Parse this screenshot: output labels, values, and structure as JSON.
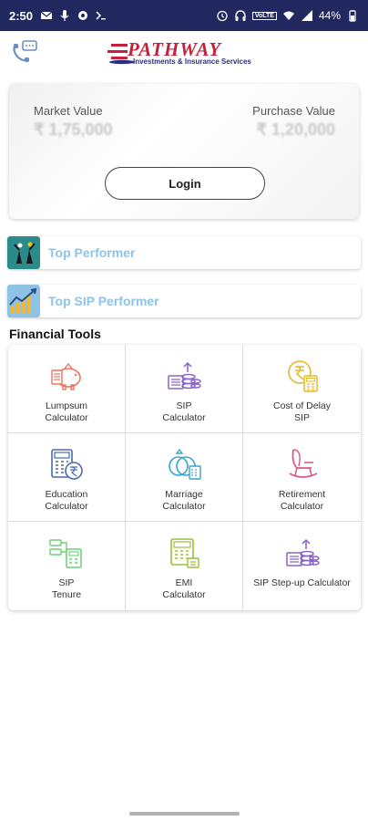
{
  "status_bar": {
    "time": "2:50",
    "network_label": "VoLTE",
    "battery": "44%"
  },
  "header": {
    "brand": "PATHWAY",
    "subtitle": "Investments & Insurance Services"
  },
  "market_card": {
    "market_value_label": "Market Value",
    "market_value": "₹ 1,75,000",
    "purchase_value_label": "Purchase Value",
    "purchase_value": "₹ 1,20,000",
    "login_label": "Login"
  },
  "performers": [
    {
      "label": "Top Performer",
      "icon": "top-performer-icon"
    },
    {
      "label": "Top SIP Performer",
      "icon": "top-sip-performer-icon"
    }
  ],
  "financial_tools": {
    "title": "Financial Tools",
    "items": [
      {
        "label": "Lumpsum\nCalculator",
        "icon": "piggy-bank-icon",
        "color": "#f0735f"
      },
      {
        "label": "SIP\nCalculator",
        "icon": "coin-stack-icon",
        "color": "#8a63c9"
      },
      {
        "label": "Cost of Delay\nSIP",
        "icon": "rupee-calculator-icon",
        "color": "#e6b826"
      },
      {
        "label": "Education\nCalculator",
        "icon": "education-calculator-icon",
        "color": "#4a6bb5"
      },
      {
        "label": "Marriage\nCalculator",
        "icon": "marriage-rings-icon",
        "color": "#3ba4c9"
      },
      {
        "label": "Retirement\nCalculator",
        "icon": "rocking-chair-icon",
        "color": "#d95a82"
      },
      {
        "label": "SIP\nTenure",
        "icon": "sip-tenure-icon",
        "color": "#6bcf74"
      },
      {
        "label": "EMI\nCalculator",
        "icon": "emi-calendar-icon",
        "color": "#9bbf3a"
      },
      {
        "label": "SIP Step-up Calculator",
        "icon": "step-up-coins-icon",
        "color": "#8a63c9"
      }
    ]
  }
}
